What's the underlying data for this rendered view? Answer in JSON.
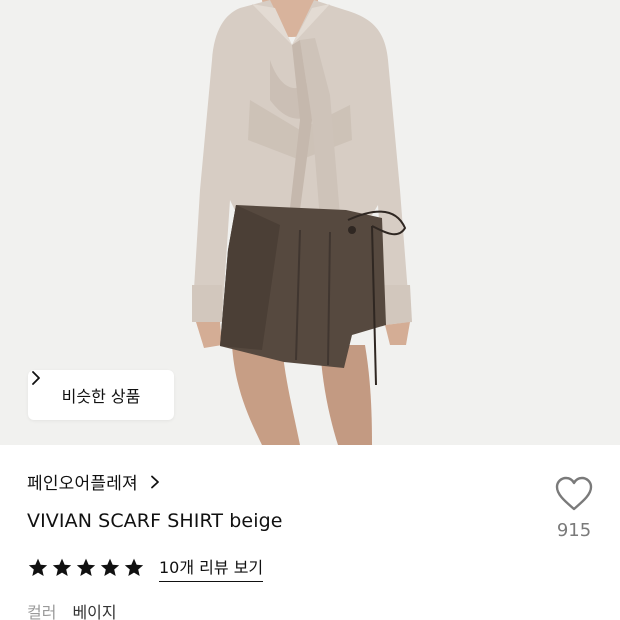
{
  "similar_button": {
    "label": "비슷한 상품"
  },
  "brand": {
    "name": "페인오어플레져"
  },
  "product": {
    "title": "VIVIAN SCARF SHIRT beige"
  },
  "like": {
    "count": "915"
  },
  "rating": {
    "stars": 5,
    "review_link": "10개 리뷰 보기"
  },
  "color": {
    "label": "컬러",
    "value": "베이지"
  },
  "colors": {
    "accent": "#111111",
    "muted": "#9a9a9a",
    "count": "#7a7a7a",
    "hero_bg": "#f1f1ef"
  },
  "icons": {
    "chevron": "chevron-right-icon",
    "heart": "heart-outline-icon",
    "star": "star-filled-icon"
  }
}
